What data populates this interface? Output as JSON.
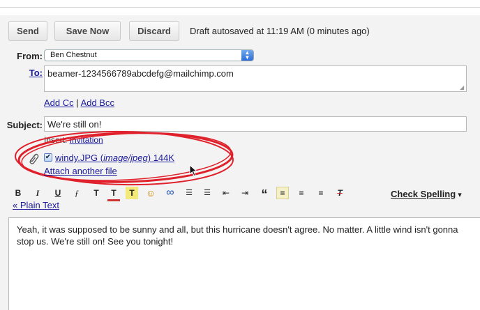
{
  "actions": {
    "send_label": "Send",
    "save_now_label": "Save Now",
    "discard_label": "Discard",
    "draft_status": "Draft autosaved at 11:19 AM (0 minutes ago)"
  },
  "from": {
    "label": "From:",
    "selected": "Ben Chestnut"
  },
  "to": {
    "label": "To:",
    "value": "beamer-1234566789abcdefg@mailchimp.com"
  },
  "cc": {
    "add_cc": "Add Cc",
    "separator": "|",
    "add_bcc": "Add Bcc"
  },
  "subject": {
    "label": "Subject:",
    "value": "We're still on!"
  },
  "insert": {
    "prefix": "Insert:",
    "invitation": "Invitation"
  },
  "attachment": {
    "filename": "windy.JPG",
    "mime": "image/jpeg",
    "size": "144K",
    "attach_another": "Attach another file",
    "highlight_color": "#e0202a"
  },
  "toolbar": {
    "bold": "B",
    "italic": "I",
    "underline": "U",
    "font": "ƒ",
    "size": "T",
    "color": "T",
    "highlight": "T",
    "emoji": "☺",
    "link": "∞",
    "numbered": "☰",
    "bullets": "☰",
    "outdent": "⇤",
    "indent": "⇥",
    "quote": "“",
    "align_left": "≡",
    "align_center": "≡",
    "align_right": "≡",
    "clear": "T",
    "check_spelling": "Check Spelling",
    "check_arrow": "▾",
    "plain_text": "« Plain Text"
  },
  "message": {
    "body": "Yeah, it was supposed to be sunny and all, but this hurricane doesn't agree. No matter. A little wind isn't gonna stop us. We're still on! See you tonight!"
  }
}
